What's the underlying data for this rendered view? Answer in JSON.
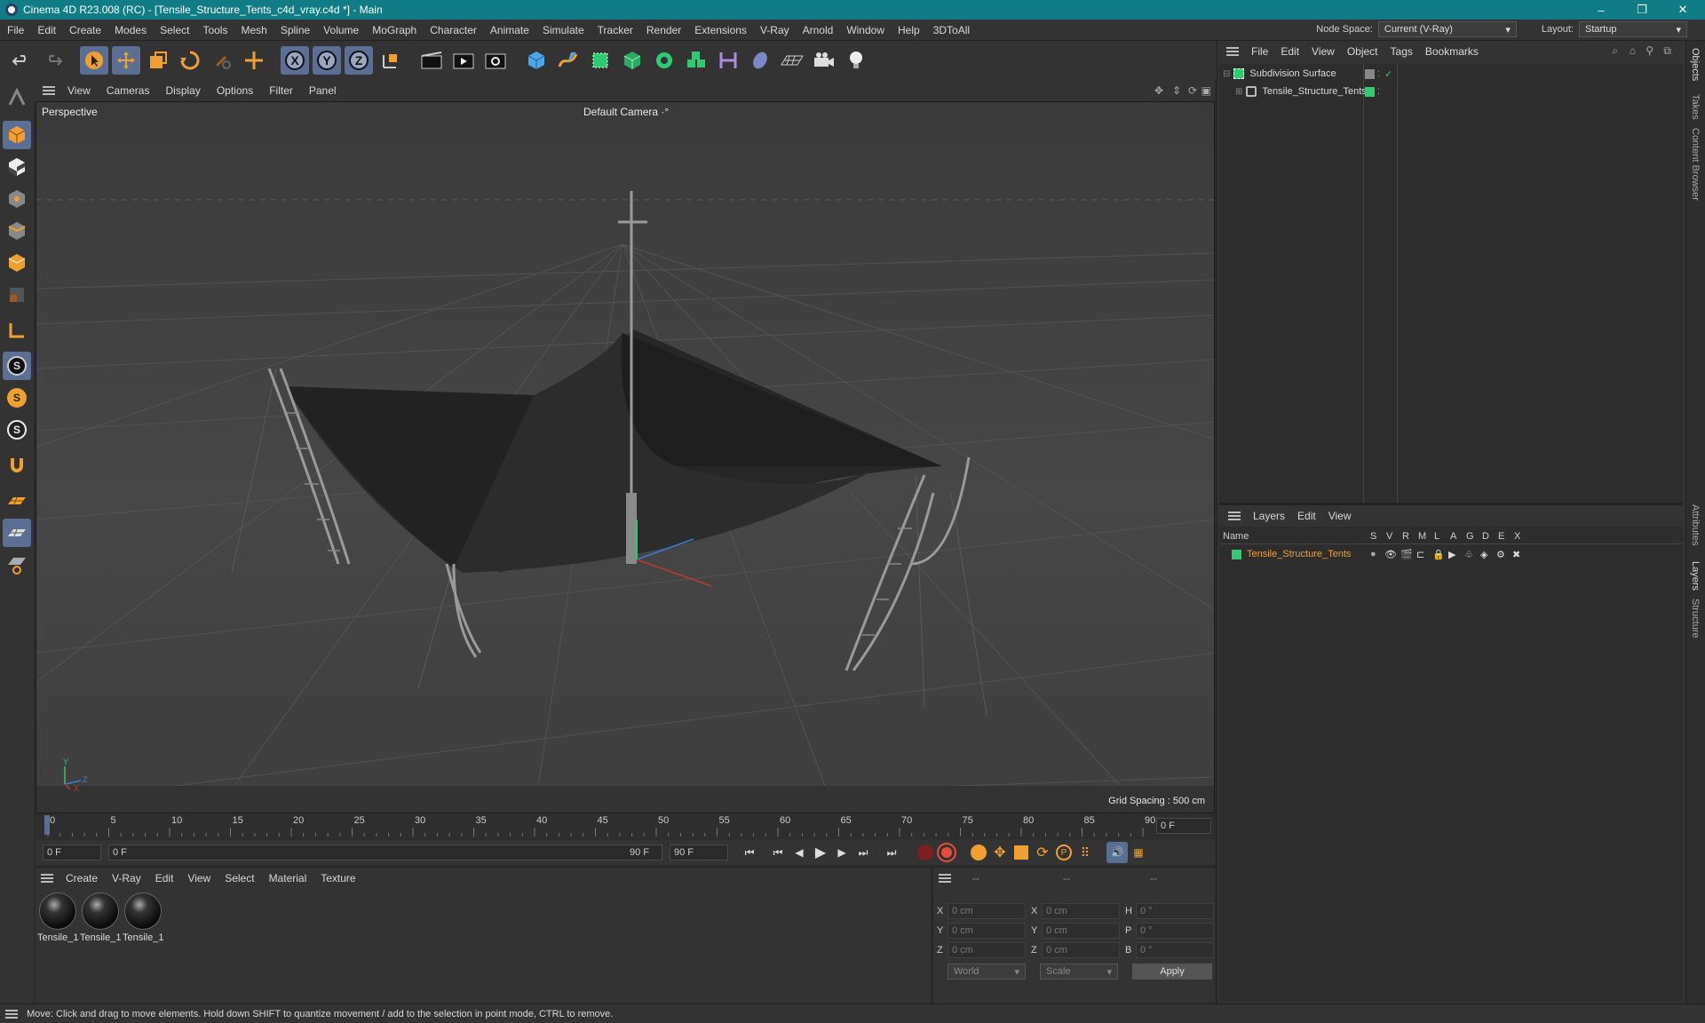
{
  "window": {
    "title": "Cinema 4D R23.008 (RC) - [Tensile_Structure_Tents_c4d_vray.c4d *] - Main",
    "minimize_glyph": "–",
    "restore_glyph": "❐",
    "close_glyph": "✕"
  },
  "menubar": {
    "items": [
      "File",
      "Edit",
      "Create",
      "Modes",
      "Select",
      "Tools",
      "Mesh",
      "Spline",
      "Volume",
      "MoGraph",
      "Character",
      "Animate",
      "Simulate",
      "Tracker",
      "Render",
      "Extensions",
      "V-Ray",
      "Arnold",
      "Window",
      "Help",
      "3DToAll"
    ],
    "node_space_label": "Node Space:",
    "node_space_value": "Current (V-Ray)",
    "layout_label": "Layout:",
    "layout_value": "Startup"
  },
  "toolbar": {
    "axis_x": "X",
    "axis_y": "Y",
    "axis_z": "Z"
  },
  "viewport_menu": {
    "items": [
      "View",
      "Cameras",
      "Display",
      "Options",
      "Filter",
      "Panel"
    ]
  },
  "viewport": {
    "view_name": "Perspective",
    "camera_name": "Default Camera",
    "camera_suffix": "·°",
    "grid_spacing": "Grid Spacing : 500 cm",
    "axis_x": "X",
    "axis_y": "Y",
    "axis_z": "Z"
  },
  "timeline": {
    "ticks": [
      "0",
      "5",
      "10",
      "15",
      "20",
      "25",
      "30",
      "35",
      "40",
      "45",
      "50",
      "55",
      "60",
      "65",
      "70",
      "75",
      "80",
      "85",
      "90"
    ],
    "current_frame_right": "0 F"
  },
  "transport": {
    "start_frame": "0 F",
    "range_start": "0 F",
    "range_end": "90 F",
    "end_frame": "90 F"
  },
  "material_panel": {
    "menu": [
      "Create",
      "V-Ray",
      "Edit",
      "View",
      "Select",
      "Material",
      "Texture"
    ],
    "materials": [
      "Tensile_1",
      "Tensile_1",
      "Tensile_1"
    ]
  },
  "coord_panel": {
    "headers": [
      "--",
      "--",
      "--"
    ],
    "rows": [
      {
        "a1": "X",
        "v1": "0 cm",
        "a2": "X",
        "v2": "0 cm",
        "a3": "H",
        "v3": "0 °"
      },
      {
        "a1": "Y",
        "v1": "0 cm",
        "a2": "Y",
        "v2": "0 cm",
        "a3": "P",
        "v3": "0 °"
      },
      {
        "a1": "Z",
        "v1": "0 cm",
        "a2": "Z",
        "v2": "0 cm",
        "a3": "B",
        "v3": "0 °"
      }
    ],
    "space": "World",
    "mode": "Scale",
    "apply_label": "Apply"
  },
  "object_manager": {
    "menu": [
      "File",
      "Edit",
      "View",
      "Object",
      "Tags",
      "Bookmarks"
    ],
    "objects": [
      {
        "name": "Subdivision Surface"
      },
      {
        "name": "Tensile_Structure_Tents"
      }
    ]
  },
  "layer_manager": {
    "menu": [
      "Layers",
      "Edit",
      "View"
    ],
    "name_header": "Name",
    "columns": [
      "S",
      "V",
      "R",
      "M",
      "L",
      "A",
      "G",
      "D",
      "E",
      "X"
    ],
    "layers": [
      {
        "name": "Tensile_Structure_Tents",
        "color": "#2ecc71"
      }
    ]
  },
  "side_tabs": [
    "Objects",
    "Takes",
    "Content Browser",
    "Attributes",
    "Layers",
    "Structure"
  ],
  "status": {
    "text": "Move: Click and drag to move elements. Hold down SHIFT to quantize movement / add to the selection in point mode, CTRL to remove."
  },
  "colors": {
    "titlebar": "#0f7c86",
    "accent_orange": "#f0a030",
    "layer_green": "#2ecc71",
    "selected_tool": "#5b6e93"
  }
}
